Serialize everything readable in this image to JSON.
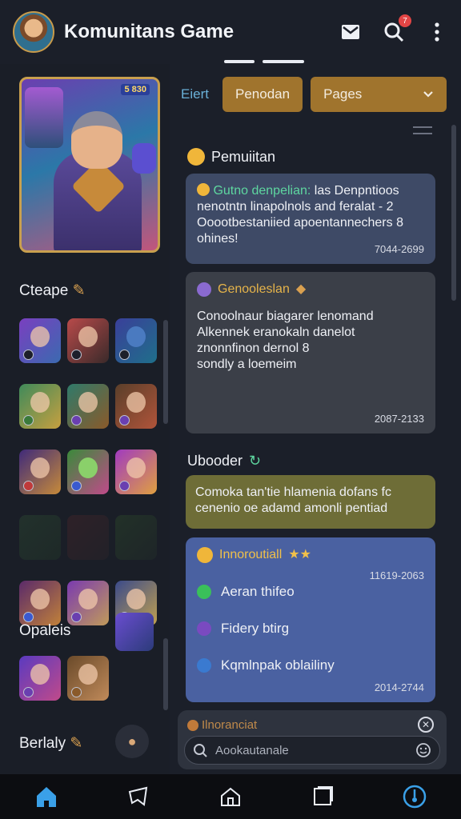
{
  "header": {
    "title": "Komunitans Game",
    "notification_count": "7"
  },
  "sidebar": {
    "featured_level": "5 830",
    "section1": "Cteape",
    "section2": "Opaleis",
    "section3": "Berlaly"
  },
  "filters": {
    "label": "Eiert",
    "chip1": "Penodan",
    "chip2": "Pages"
  },
  "main": {
    "section1_title": "Pemuiitan",
    "card1": {
      "lead": "Gutno denpelian:",
      "text_tail": " las Denpntioos",
      "line2": "nenotntn linapolnols and feralat - 2",
      "line3": "Ooootbestaniied apoentannechers 8",
      "line4": "ohines!",
      "time": "7044-2699"
    },
    "card2": {
      "title": "Genooleslan",
      "line1": "Conoolnaur biagarer lenomand",
      "line2": "Alkennek eranokaln danelot",
      "line3": "znonnfinon dernol 8",
      "line4": "sondly a loemeim",
      "time": "2087-2133"
    },
    "section2_title": "Ubooder",
    "card3": {
      "line1": "Comoka tan'tie hlamenia dofans fc",
      "line2": "cenenio oe adamd amonli pentiad"
    },
    "card4": {
      "title": "Innoroutiall",
      "top_time": "11619-2063",
      "opt1": "Aeran thifeo",
      "opt2": "Fidery btirg",
      "opt3": "Kqmlnpak oblailiny",
      "time": "2014-2744"
    },
    "comment": {
      "label": "Ilnoranciat",
      "placeholder": "Aookautanale"
    }
  },
  "colors": {
    "accent": "#a0742d",
    "card_blue": "#4a61a1",
    "card_olive": "#6e6d37",
    "active_nav": "#3aa0e8"
  }
}
